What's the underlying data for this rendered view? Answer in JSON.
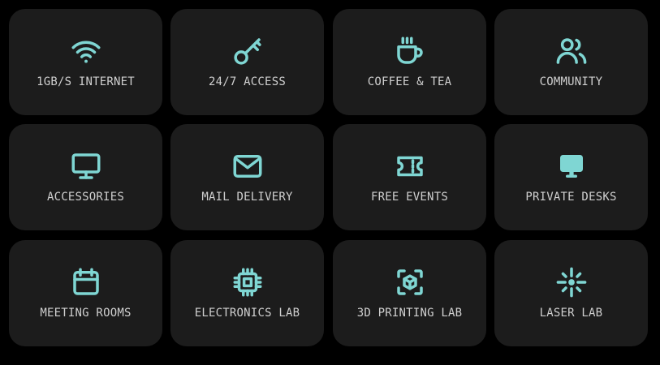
{
  "accent_color": "#7fd6d3",
  "card_bg": "#1c1c1c",
  "amenities": [
    {
      "label": "1GB/S INTERNET",
      "icon": "wifi-icon"
    },
    {
      "label": "24/7 ACCESS",
      "icon": "key-icon"
    },
    {
      "label": "COFFEE & TEA",
      "icon": "coffee-cup-icon"
    },
    {
      "label": "COMMUNITY",
      "icon": "users-icon"
    },
    {
      "label": "ACCESSORIES",
      "icon": "monitor-icon"
    },
    {
      "label": "MAIL DELIVERY",
      "icon": "mail-icon"
    },
    {
      "label": "FREE EVENTS",
      "icon": "ticket-icon"
    },
    {
      "label": "PRIVATE DESKS",
      "icon": "desk-monitor-icon"
    },
    {
      "label": "MEETING ROOMS",
      "icon": "calendar-icon"
    },
    {
      "label": "ELECTRONICS LAB",
      "icon": "chip-icon"
    },
    {
      "label": "3D PRINTING LAB",
      "icon": "cube-scan-icon"
    },
    {
      "label": "LASER LAB",
      "icon": "laser-icon"
    }
  ]
}
